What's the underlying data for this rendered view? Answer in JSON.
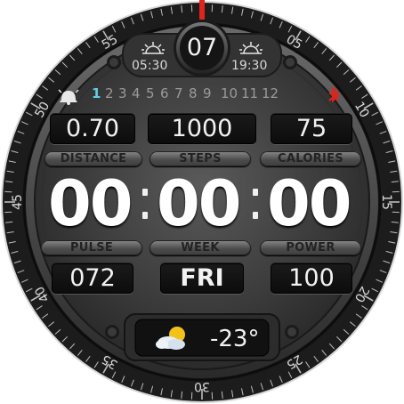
{
  "date_day": "07",
  "sunrise": "05:30",
  "sunset": "19:30",
  "hour_numbers": [
    "1",
    "2",
    "3",
    "4",
    "5",
    "6",
    "7",
    "8",
    "9",
    "10",
    "11",
    "12"
  ],
  "active_hour": "1",
  "metrics_top": {
    "distance": {
      "value": "0.70",
      "label": "DISTANCE"
    },
    "steps": {
      "value": "1000",
      "label": "STEPS"
    },
    "calories": {
      "value": "75",
      "label": "CALORIES"
    }
  },
  "time": {
    "hours": "00",
    "minutes": "00",
    "seconds": "00"
  },
  "metrics_bottom": {
    "pulse": {
      "value": "072",
      "label": "PULSE"
    },
    "week": {
      "value": "FRI",
      "label": "WEEK"
    },
    "power": {
      "value": "100",
      "label": "POWER"
    }
  },
  "weather": {
    "temperature": "-23°",
    "icon": "partly-cloudy-icon"
  },
  "bezel_numbers": [
    "05",
    "10",
    "15",
    "20",
    "25",
    "30",
    "35",
    "40",
    "45",
    "50",
    "55"
  ],
  "colors": {
    "accent": "#e0231b",
    "active_hour": "#5fd0e8",
    "bluetooth": "#e0231b"
  }
}
